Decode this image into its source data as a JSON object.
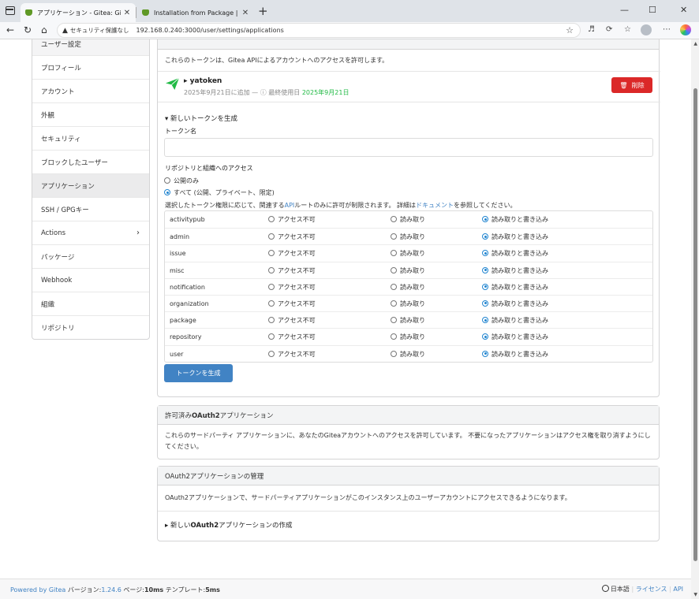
{
  "browser": {
    "tabs": [
      {
        "label": "アプリケーション - Gitea: Git with a c",
        "active": true
      },
      {
        "label": "Installation from Package | Gitea D",
        "active": false
      }
    ],
    "security_label": "セキュリティ保護なし",
    "url": "192.168.0.240:3000/user/settings/applications",
    "window_controls": {
      "minimize": "—",
      "maximize": "☐",
      "close": "✕"
    },
    "colors": {
      "favicon": "#609926"
    }
  },
  "sidebar": {
    "items": [
      {
        "label": "ユーザー設定"
      },
      {
        "label": "プロフィール"
      },
      {
        "label": "アカウント"
      },
      {
        "label": "外観"
      },
      {
        "label": "セキュリティ"
      },
      {
        "label": "ブロックしたユーザー"
      },
      {
        "label": "アプリケーション",
        "selected": true
      },
      {
        "label": "SSH / GPGキー"
      },
      {
        "label": "Actions",
        "chevron": "›"
      },
      {
        "label": "パッケージ"
      },
      {
        "label": "Webhook"
      },
      {
        "label": "組織"
      },
      {
        "label": "リポジトリ"
      }
    ]
  },
  "tokens_panel": {
    "description": "これらのトークンは、Gitea APIによるアカウントへのアクセスを許可します。",
    "token": {
      "name": "yatoken",
      "added_text": "2025年9月21日に追加 —",
      "last_used_label": "最終使用日",
      "last_used_value": "2025年9月21日",
      "delete_label": "削除"
    },
    "new_token": {
      "summary": "新しいトークンを生成",
      "name_label": "トークン名",
      "name_value": "",
      "access_label": "リポジトリと組織へのアクセス",
      "access_options": [
        {
          "label": "公開のみ",
          "selected": false
        },
        {
          "label": "すべて (公開、プライベート、限定)",
          "selected": true
        }
      ],
      "scope_note": {
        "part1": "選択したトークン権限に応じて、関連する",
        "api_link": "API",
        "part2": "ルートのみに許可が制限されます。 詳細は",
        "docs_link": "ドキュメント",
        "part3": "を参照してください。"
      },
      "permission_levels": [
        "アクセス不可",
        "読み取り",
        "読み取りと書き込み"
      ],
      "permissions": [
        {
          "name": "activitypub",
          "level": "読み取りと書き込み"
        },
        {
          "name": "admin",
          "level": "読み取りと書き込み"
        },
        {
          "name": "issue",
          "level": "読み取りと書き込み"
        },
        {
          "name": "misc",
          "level": "読み取りと書き込み"
        },
        {
          "name": "notification",
          "level": "読み取りと書き込み"
        },
        {
          "name": "organization",
          "level": "読み取りと書き込み"
        },
        {
          "name": "package",
          "level": "読み取りと書き込み"
        },
        {
          "name": "repository",
          "level": "読み取りと書き込み"
        },
        {
          "name": "user",
          "level": "読み取りと書き込み"
        }
      ],
      "generate_label": "トークンを生成"
    }
  },
  "oauth_authorized": {
    "title_prefix": "許可済み",
    "title_bold": "OAuth2",
    "title_suffix": "アプリケーション",
    "text": "これらのサードパーティ アプリケーションに、あなたのGiteaアカウントへのアクセスを許可しています。 不要になったアプリケーションはアクセス権を取り消すようにしてください。"
  },
  "oauth_manage": {
    "title": "OAuth2アプリケーションの管理",
    "text": "OAuth2アプリケーションで、サードパーティアプリケーションがこのインスタンス上のユーザーアカウントにアクセスできるようになります。",
    "new_prefix": "新しい",
    "new_bold": "OAuth2",
    "new_suffix": "アプリケーションの作成"
  },
  "footer": {
    "powered_by": "Powered by Gitea",
    "version_label": "バージョン:",
    "version": "1.24.6",
    "page_label": "ページ:",
    "page_time": "10ms",
    "template_label": "テンプレート:",
    "template_time": "5ms",
    "language": "日本語",
    "license": "ライセンス",
    "api": "API"
  },
  "colors": {
    "primary": "#4183c4",
    "danger": "#db2828",
    "success": "#21ba45"
  }
}
